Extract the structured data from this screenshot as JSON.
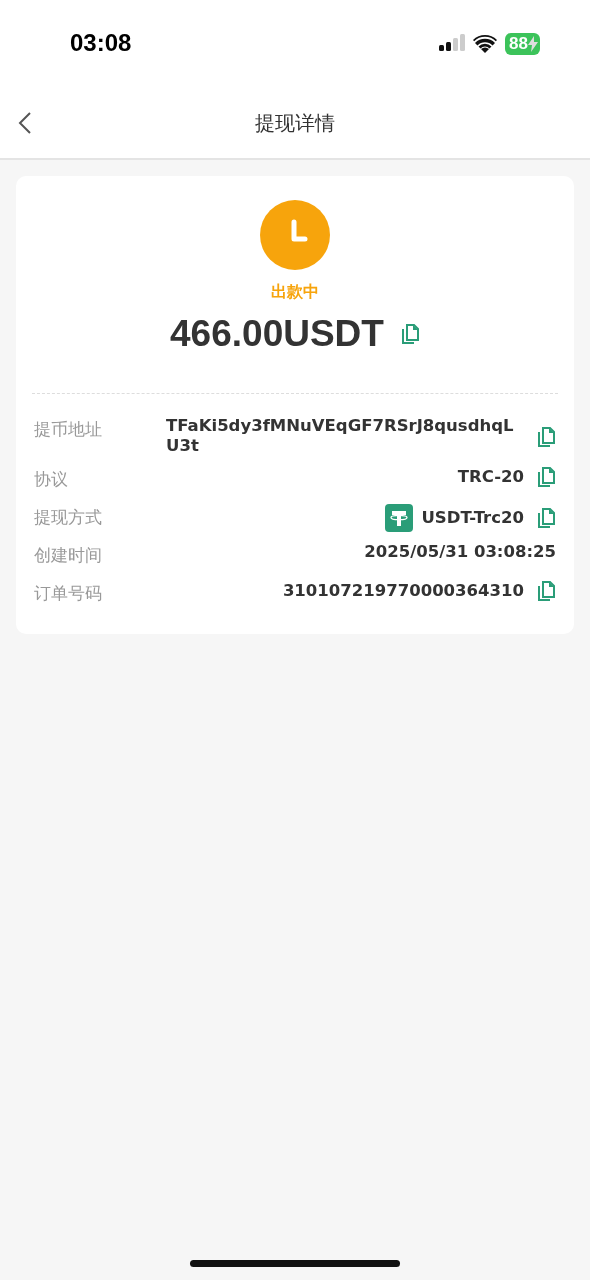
{
  "status_bar": {
    "time": "03:08",
    "battery": "88",
    "charging": true
  },
  "header": {
    "title": "提现详情"
  },
  "status": {
    "label": "出款中",
    "kind": "pending"
  },
  "amount": {
    "text": "466.00USDT",
    "copyable": true
  },
  "details": [
    {
      "label": "提币地址",
      "value": "TFaKi5dy3fMNuVEqGF7RSrJ8qusdhqLU3t",
      "kind": "text",
      "copyable": true
    },
    {
      "label": "协议",
      "value": "TRC-20",
      "kind": "text",
      "copyable": true
    },
    {
      "label": "提现方式",
      "value": "USDT-Trc20",
      "kind": "token",
      "copyable": true
    },
    {
      "label": "创建时间",
      "value": "2025/05/31 03:08:25",
      "kind": "text",
      "copyable": false
    },
    {
      "label": "订单号码",
      "value": "310107219770000364310",
      "kind": "text",
      "copyable": true
    }
  ]
}
